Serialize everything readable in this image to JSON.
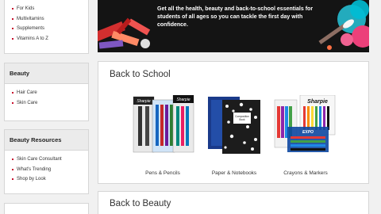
{
  "sidebar": {
    "top_items": [
      "For Kids",
      "Multivitamins",
      "Supplements",
      "Vitamins A to Z"
    ],
    "beauty": {
      "heading": "Beauty",
      "items": [
        "Hair Care",
        "Skin Care"
      ]
    },
    "resources": {
      "heading": "Beauty Resources",
      "items": [
        "Skin Care Consultant",
        "What's Trending",
        "Shop by Look"
      ]
    }
  },
  "banner": {
    "text": "Get all the health, beauty and back-to-school essentials for students of all ages so you can tackle the first day with confidence."
  },
  "back_to_school": {
    "title": "Back to School",
    "products": [
      {
        "label": "Pens & Pencils",
        "image_brand": "Sharpie"
      },
      {
        "label": "Paper & Notebooks",
        "image_brand": "Composition Book"
      },
      {
        "label": "Crayons & Markers",
        "image_brand": "Sharpie"
      }
    ]
  },
  "back_to_beauty": {
    "title": "Back to Beauty"
  },
  "colors": {
    "accent": "#c8102e",
    "banner_bg": "#141414",
    "panel_border": "#d6d6d6"
  }
}
